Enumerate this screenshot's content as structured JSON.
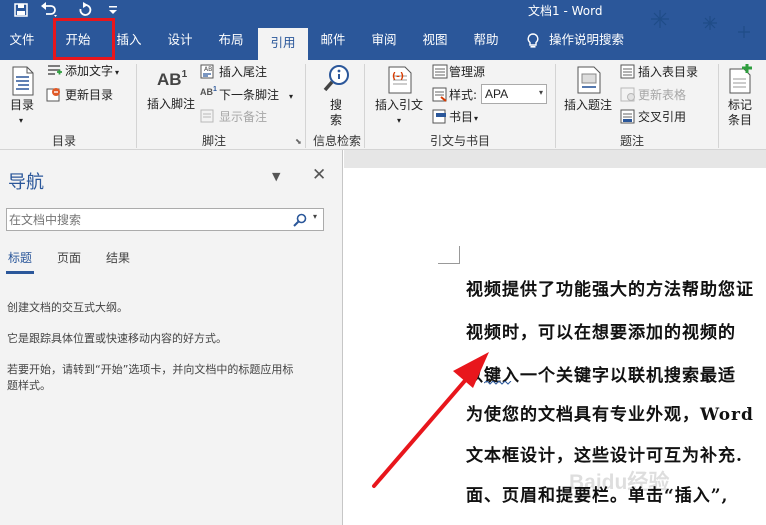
{
  "titlebar": {
    "title": "文档1 - Word"
  },
  "tabs": [
    "文件",
    "开始",
    "插入",
    "设计",
    "布局",
    "引用",
    "邮件",
    "审阅",
    "视图",
    "帮助"
  ],
  "tell_me": "操作说明搜索",
  "ribbon": {
    "toc": "目录",
    "add_text": "添加文字",
    "update_toc": "更新目录",
    "grp_toc": "目录",
    "insert_endnote": "插入尾注",
    "insert_footnote": "插入脚注",
    "next_footnote": "下一条脚注",
    "show_notes": "显示备注",
    "grp_footnotes": "脚注",
    "search": "搜索",
    "grp_research": "信息检索",
    "insert_citation": "插入引文",
    "manage_sources": "管理源",
    "style_label": "样式:",
    "style_value": "APA",
    "bibliography": "书目",
    "grp_citations": "引文与书目",
    "insert_caption": "插入题注",
    "insert_table_of_figures": "插入表目录",
    "update_table": "更新表格",
    "cross_reference": "交叉引用",
    "grp_captions": "题注",
    "mark_entry": "标记条目"
  },
  "nav": {
    "title": "导航",
    "search_placeholder": "在文档中搜索",
    "tabs": [
      "标题",
      "页面",
      "结果"
    ],
    "p1": "创建文档的交互式大纲。",
    "p2": "它是跟踪具体位置或快速移动内容的好方式。",
    "p3a": "若要开始，请转到“开始”选项卡，并向文档中的标题应用标",
    "p3b": "题样式。"
  },
  "document": {
    "lines": [
      "视频提供了功能强大的方法帮助您证",
      "视频时，可以在想要添加的视频的",
      "以键入一个关键字以联机搜索最适",
      "为使您的文档具有专业外观，Word",
      "文本框设计，这些设计可互为补充.",
      "面、页眉和提要栏。单击“插入”,"
    ]
  },
  "watermark": "Baidu经验",
  "colors": {
    "accent": "#2b579a",
    "highlight": "#e8161c"
  }
}
